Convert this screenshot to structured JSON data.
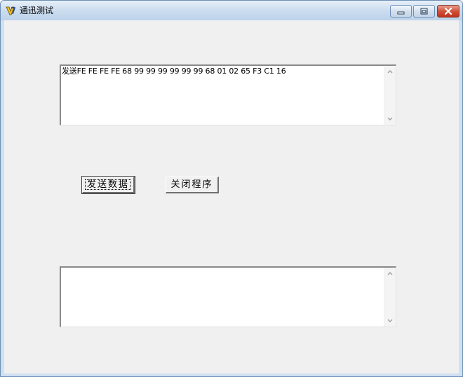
{
  "window": {
    "title": "通迅测试"
  },
  "content": {
    "send_textbox_value": "发送FE FE FE FE 68 99 99 99 99 99 99 68 01 02 65 F3 C1 16",
    "receive_textbox_value": ""
  },
  "buttons": {
    "send_label": "发送数据",
    "close_label": "关闭程序"
  },
  "colors": {
    "client_background": "#f0f0f0",
    "close_button": "#c1321c"
  }
}
